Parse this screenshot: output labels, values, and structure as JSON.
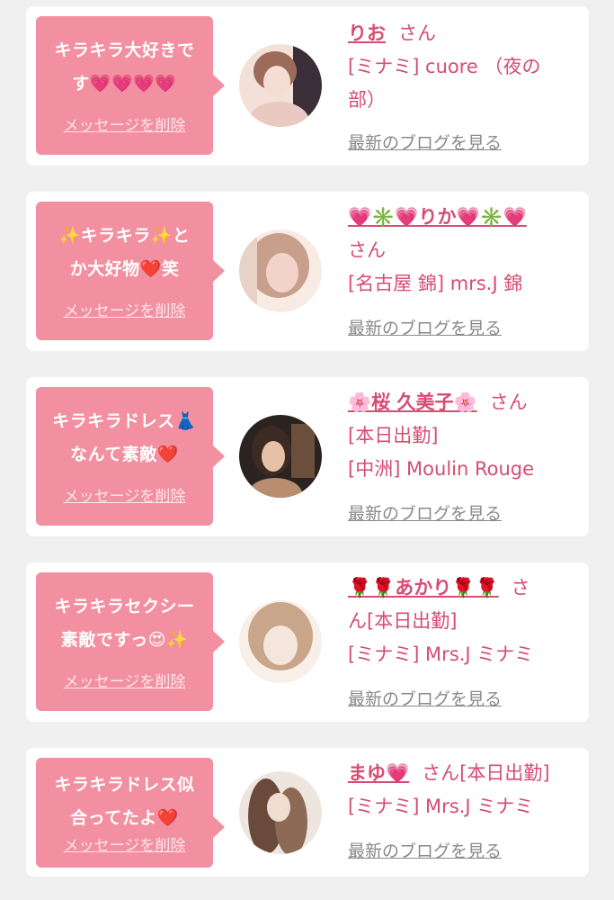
{
  "delete_label": "メッセージを削除",
  "san_label": "さん",
  "blog_label": "最新のブログを見る",
  "items": [
    {
      "message_line1": "キラキラ大好きで",
      "message_line2": "す💗💗💗💗",
      "name": "りお",
      "line2": "[ミナミ] cuore （夜の",
      "line3": "部）",
      "avatar_colors": [
        "#3a2f38",
        "#e9c9c2",
        "#f3e1d9"
      ]
    },
    {
      "message_line1": "✨キラキラ✨と",
      "message_line2": "か大好物❤️笑",
      "name": "💗✳️💗りか💗✳️💗",
      "line2": "さん",
      "line3": "[名古屋 錦] mrs.J 錦",
      "avatar_colors": [
        "#f2d3c9",
        "#c79f8a",
        "#f7ebe4"
      ]
    },
    {
      "message_line1": "キラキラドレス👗",
      "message_line2": "なんて素敵❤️",
      "name": "🌸桜 久美子🌸",
      "line2": "[本日出勤]",
      "line3": "[中洲] Moulin Rouge",
      "avatar_colors": [
        "#2a2320",
        "#b98d6f",
        "#6b4e3c"
      ]
    },
    {
      "message_line1": "キラキラセクシー",
      "message_line2": "素敵ですっ😍✨",
      "name": "🌹🌹あかり🌹🌹",
      "line2": "ん[本日出勤]",
      "line3": "[ミナミ] Mrs.J ミナミ",
      "avatar_colors": [
        "#f4e6dc",
        "#c9a58a",
        "#f9efe9"
      ]
    },
    {
      "message_line1": "キラキラドレス似",
      "message_line2": "合ってたよ❤️",
      "name": "まゆ💗",
      "line2": "[ミナミ] Mrs.J ミナミ",
      "line3": "",
      "avatar_colors": [
        "#6a4a3a",
        "#efe5df",
        "#8c6a55"
      ]
    }
  ]
}
